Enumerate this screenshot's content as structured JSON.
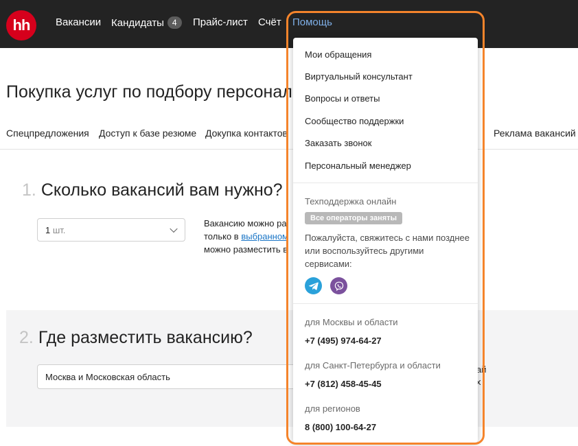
{
  "header": {
    "logo": "hh",
    "nav": [
      {
        "label": "Вакансии"
      },
      {
        "label": "Кандидаты",
        "badge": "4"
      },
      {
        "label": "Прайс-лист"
      },
      {
        "label": "Счёт"
      },
      {
        "label": "Помощь",
        "active": true
      }
    ]
  },
  "page": {
    "title": "Покупка услуг по подбору персонала",
    "tabs": [
      "Спецпредложения",
      "Доступ к базе резюме",
      "Докупка контактов",
      "Реклама вакансий"
    ]
  },
  "section1": {
    "number": "1.",
    "title": "Сколько вакансий вам нужно?",
    "select_value": "1",
    "select_unit": "шт.",
    "info_line1": "Вакансию можно разм",
    "info_line2_prefix": "только в ",
    "info_link": "выбранном р",
    "info_line3": "можно разместить в то"
  },
  "section2": {
    "number": "2.",
    "title": "Где разместить вакансию?",
    "select_value": "Москва и Московская область",
    "edge_line1": "ай",
    "edge_line2": "х"
  },
  "dropdown": {
    "items": [
      "Мои обращения",
      "Виртуальный консультант",
      "Вопросы и ответы",
      "Сообщество поддержки",
      "Заказать звонок",
      "Персональный менеджер"
    ],
    "support_title": "Техподдержка онлайн",
    "support_status": "Все операторы заняты",
    "support_note": "Пожалуйста, свяжитесь с нами позднее или воспользуйтесь другими сервисами:",
    "contacts": [
      {
        "region": "для Москвы и области",
        "phone": "+7 (495) 974-64-27"
      },
      {
        "region": "для Санкт-Петербурга и области",
        "phone": "+7 (812) 458-45-45"
      },
      {
        "region": "для регионов",
        "phone": "8 (800) 100-64-27"
      }
    ]
  },
  "colors": {
    "header_bg": "#232323",
    "logo_red": "#d6001c",
    "active_link": "#7fb0e8",
    "highlight_orange": "#f5842b",
    "link_blue": "#1a75c6",
    "telegram": "#2aa1da",
    "viber": "#7b519d"
  },
  "icons": [
    "telegram-icon",
    "viber-icon",
    "chevron-down-icon"
  ]
}
